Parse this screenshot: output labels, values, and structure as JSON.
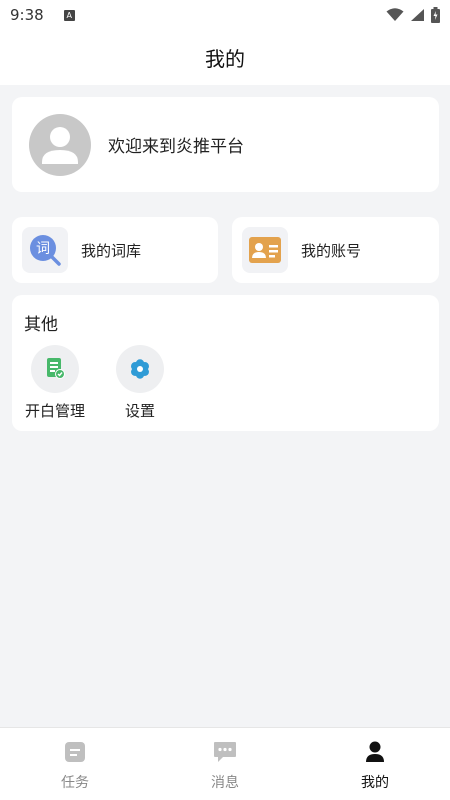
{
  "status_bar": {
    "time": "9:38",
    "notification_letter": "A"
  },
  "header": {
    "title": "我的"
  },
  "profile": {
    "welcome": "欢迎来到炎推平台"
  },
  "quick_cards": [
    {
      "label": "我的词库",
      "icon": "lexicon-icon",
      "icon_glyph": "词",
      "color": "#6b8fe0"
    },
    {
      "label": "我的账号",
      "icon": "id-card-icon",
      "color": "#e3a24d"
    }
  ],
  "other": {
    "title": "其他",
    "tools": [
      {
        "label": "开白管理",
        "icon": "checklist-icon",
        "color": "#47b86a"
      },
      {
        "label": "设置",
        "icon": "gear-icon",
        "color": "#2f9bd6"
      }
    ]
  },
  "bottom_nav": [
    {
      "label": "任务",
      "icon": "task-icon",
      "active": false
    },
    {
      "label": "消息",
      "icon": "message-icon",
      "active": false
    },
    {
      "label": "我的",
      "icon": "person-icon",
      "active": true
    }
  ],
  "colors": {
    "background": "#f3f4f6",
    "inactive": "#bfbfbf",
    "active": "#111111"
  }
}
